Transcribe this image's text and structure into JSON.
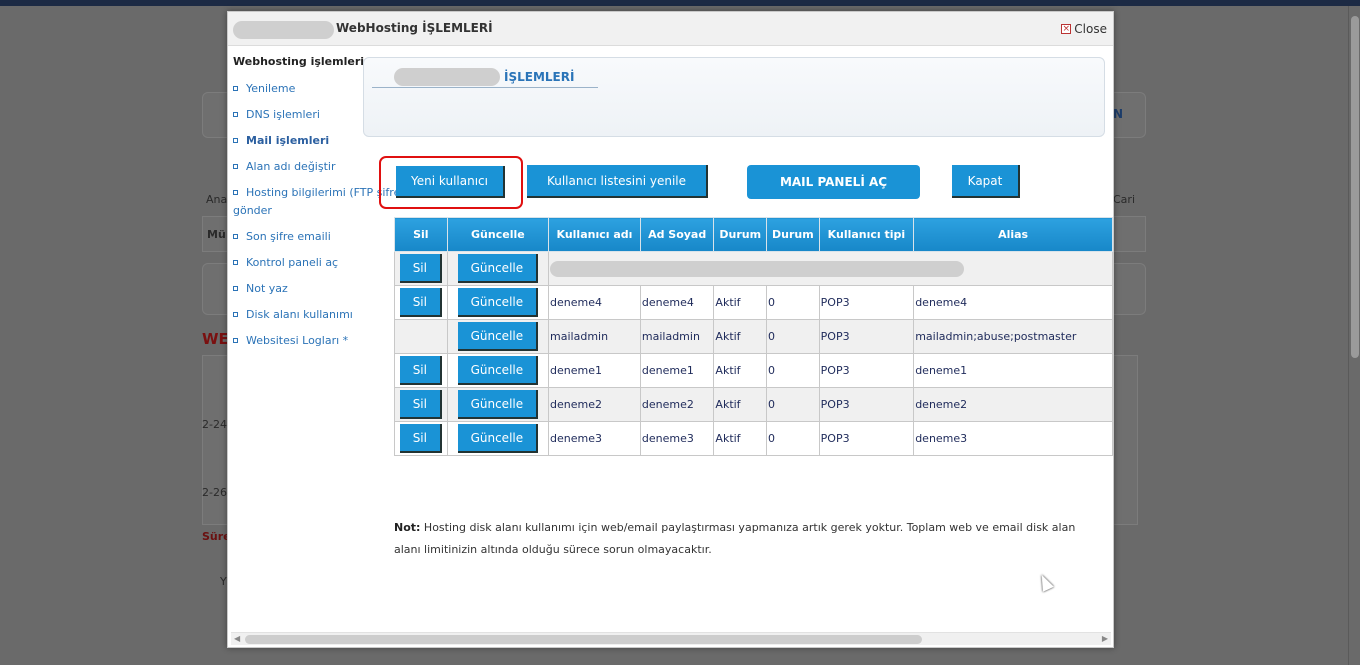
{
  "modal": {
    "title": "WebHosting İŞLEMLERİ",
    "close_label": "Close"
  },
  "left_menu": {
    "title": "Webhosting işlemleri",
    "items": [
      {
        "label": "Yenileme"
      },
      {
        "label": "DNS işlemleri"
      },
      {
        "label": "Mail işlemleri"
      },
      {
        "label": "Alan adı değiştir"
      },
      {
        "label": "Hosting bilgilerimi (FTP şifre vs) gönder"
      },
      {
        "label": "Son şifre emaili"
      },
      {
        "label": "Kontrol paneli aç"
      },
      {
        "label": "Not yaz"
      },
      {
        "label": "Disk alanı kullanımı"
      },
      {
        "label": "Websitesi Logları *"
      }
    ]
  },
  "content": {
    "title": "İŞLEMLERİ"
  },
  "actions": {
    "yeni": "Yeni kullanıcı",
    "liste": "Kullanıcı listesini yenile",
    "mail": "MAIL PANELİ AÇ",
    "kapat": "Kapat"
  },
  "table": {
    "headers": [
      "Sil",
      "Güncelle",
      "Kullanıcı adı",
      "Ad Soyad",
      "Durum",
      "Durum",
      "Kullanıcı tipi",
      "Alias"
    ],
    "sil_label": "Sil",
    "guncelle_label": "Güncelle",
    "rows": [
      {
        "user": "deneme4",
        "name": "deneme4",
        "status": "Aktif",
        "status2": "0",
        "type": "POP3",
        "alias": "deneme4"
      },
      {
        "user": "mailadmin",
        "name": "mailadmin",
        "status": "Aktif",
        "status2": "0",
        "type": "POP3",
        "alias": "mailadmin;abuse;postmaster"
      },
      {
        "user": "deneme1",
        "name": "deneme1",
        "status": "Aktif",
        "status2": "0",
        "type": "POP3",
        "alias": "deneme1"
      },
      {
        "user": "deneme2",
        "name": "deneme2",
        "status": "Aktif",
        "status2": "0",
        "type": "POP3",
        "alias": "deneme2"
      },
      {
        "user": "deneme3",
        "name": "deneme3",
        "status": "Aktif",
        "status2": "0",
        "type": "POP3",
        "alias": "deneme3"
      }
    ]
  },
  "note": {
    "label": "Not:",
    "line1": "Hosting disk alanı kullanımı için web/email paylaştırması yapmanıza artık gerek yoktur. Toplam web ve email disk alan",
    "line2": "alanı limitinizin altında olduğu sürece sorun olmayacaktır."
  },
  "background": {
    "ana": "Ana",
    "cari": "Cari",
    "mu": "Mü",
    "we": "WE",
    "date1": "2-24",
    "date2": "2-26",
    "sure": "Süre",
    "y": "Y",
    "n": "N"
  },
  "colors": {
    "button_blue": "#1a93d6",
    "highlight_red": "#e01010",
    "link_blue": "#2b73b7"
  }
}
